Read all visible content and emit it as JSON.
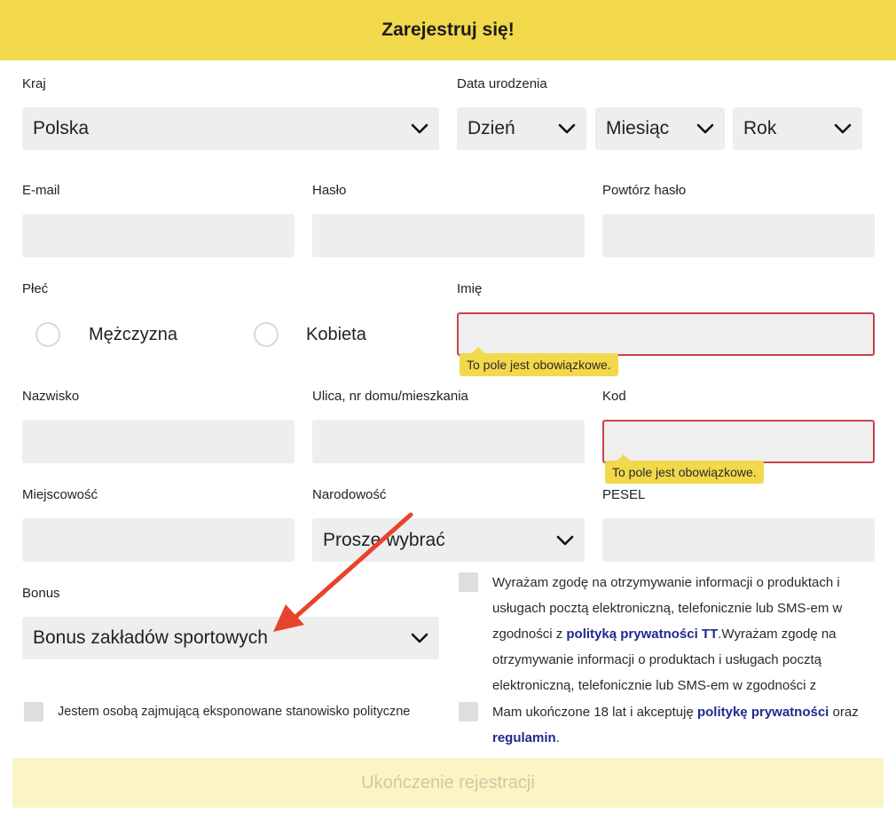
{
  "header": {
    "title": "Zarejestruj się!"
  },
  "country": {
    "label": "Kraj",
    "value": "Polska"
  },
  "birthdate": {
    "label": "Data urodzenia",
    "day": "Dzień",
    "month": "Miesiąc",
    "year": "Rok"
  },
  "email": {
    "label": "E-mail"
  },
  "password": {
    "label": "Hasło"
  },
  "password_repeat": {
    "label": "Powtórz hasło"
  },
  "gender": {
    "label": "Płeć",
    "male": "Mężczyzna",
    "female": "Kobieta"
  },
  "first_name": {
    "label": "Imię",
    "error": "To pole jest obowiązkowe."
  },
  "last_name": {
    "label": "Nazwisko"
  },
  "street": {
    "label": "Ulica, nr domu/mieszkania"
  },
  "postal_code": {
    "label": "Kod",
    "error": "To pole jest obowiązkowe."
  },
  "city": {
    "label": "Miejscowość"
  },
  "nationality": {
    "label": "Narodowość",
    "value": "Prosze wybrać"
  },
  "pesel": {
    "label": "PESEL"
  },
  "bonus": {
    "label": "Bonus",
    "value": "Bonus zakładów sportowych"
  },
  "pep": {
    "label": "Jestem osobą zajmującą eksponowane stanowisko polityczne"
  },
  "marketing_consent": {
    "line1": "Wyrażam zgodę na otrzymywanie informacji o produktach i",
    "line2": "usługach pocztą elektroniczną, telefonicznie lub SMS-em w",
    "line3_before": "zgodności z ",
    "line3_link": "polityką prywatności TT",
    "line3_after": ".Wyrażam zgodę na",
    "line4": "otrzymywanie informacji o produktach i usługach pocztą",
    "line5": "elektroniczną, telefonicznie lub SMS-em w zgodności z"
  },
  "age_consent": {
    "before": "Mam ukończone 18 lat i akceptuję ",
    "link1": "politykę prywatności",
    "middle": " oraz",
    "link2": "regulamin",
    "after": "."
  },
  "submit": {
    "label": "Ukończenie rejestracji"
  },
  "colors": {
    "header_bg": "#f2d84b",
    "error_border": "#c9424d",
    "arrow": "#e8432e",
    "link": "#1f2a8c"
  }
}
